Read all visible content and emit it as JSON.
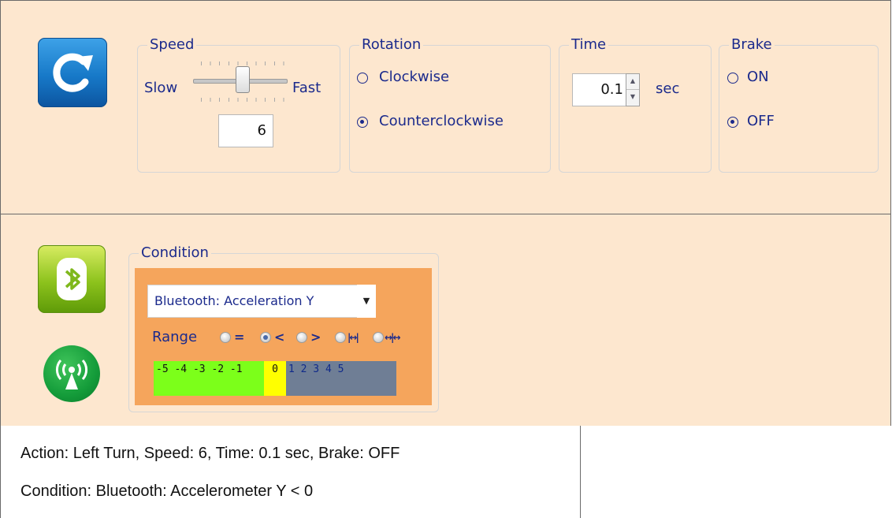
{
  "action": {
    "icon": "rotate-icon",
    "speed": {
      "legend": "Speed",
      "slow_label": "Slow",
      "fast_label": "Fast",
      "value": "6"
    },
    "rotation": {
      "legend": "Rotation",
      "options": [
        "Clockwise",
        "Counterclockwise"
      ],
      "selected": "Counterclockwise"
    },
    "time": {
      "legend": "Time",
      "value": "0.1",
      "unit": "sec"
    },
    "brake": {
      "legend": "Brake",
      "options": [
        "ON",
        "OFF"
      ],
      "selected": "OFF"
    }
  },
  "condition": {
    "icons": [
      "bluetooth-icon",
      "wireless-signal-icon"
    ],
    "legend": "Condition",
    "sensor_selected": "Bluetooth: Acceleration Y",
    "range_label": "Range",
    "range_options": [
      "=",
      "<",
      ">",
      "|↔|",
      "↔|↔"
    ],
    "range_selected": "<",
    "scale_negative": "-5 -4 -3 -2 -1",
    "scale_zero": "0",
    "scale_positive": "1  2  3  4  5",
    "colors": {
      "negative": "#7cff1a",
      "zero": "#ffff00",
      "positive": "#6f7e95",
      "background": "#f5a55c"
    }
  },
  "summary": {
    "line1": "Action: Left Turn, Speed: 6, Time: 0.1 sec, Brake: OFF",
    "line2": "Condition: Bluetooth: Accelerometer Y < 0"
  }
}
